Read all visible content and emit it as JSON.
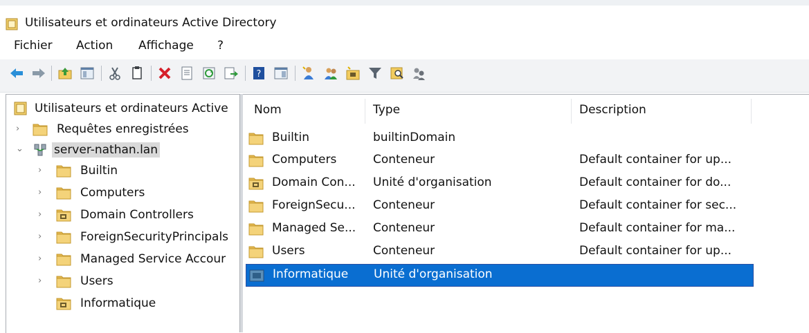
{
  "window": {
    "title": "Utilisateurs et ordinateurs Active Directory"
  },
  "menu": {
    "file": "Fichier",
    "action": "Action",
    "view": "Affichage",
    "help": "?"
  },
  "toolbar": {
    "icons": [
      "back-arrow-icon",
      "forward-arrow-icon",
      "up-folder-icon",
      "show-console-tree-icon",
      "cut-icon",
      "copy-icon",
      "delete-icon",
      "properties-icon",
      "refresh-icon",
      "export-list-icon",
      "help-icon",
      "console-icon",
      "new-user-icon",
      "new-group-icon",
      "new-ou-icon",
      "filter-icon",
      "find-icon",
      "delegate-icon"
    ]
  },
  "tree": {
    "root": "Utilisateurs et ordinateurs Active",
    "saved_queries": "Requêtes enregistrées",
    "domain": "server-nathan.lan",
    "children": [
      "Builtin",
      "Computers",
      "Domain Controllers",
      "ForeignSecurityPrincipals",
      "Managed Service Accour",
      "Users",
      "Informatique"
    ]
  },
  "list": {
    "headers": {
      "name": "Nom",
      "type": "Type",
      "description": "Description"
    },
    "rows": [
      {
        "name": "Builtin",
        "type": "builtinDomain",
        "description": ""
      },
      {
        "name": "Computers",
        "type": "Conteneur",
        "description": "Default container for up..."
      },
      {
        "name": "Domain Con...",
        "type": "Unité d'organisation",
        "description": "Default container for do..."
      },
      {
        "name": "ForeignSecu...",
        "type": "Conteneur",
        "description": "Default container for sec..."
      },
      {
        "name": "Managed Se...",
        "type": "Conteneur",
        "description": "Default container for ma..."
      },
      {
        "name": "Users",
        "type": "Conteneur",
        "description": "Default container for up..."
      },
      {
        "name": "Informatique",
        "type": "Unité d'organisation",
        "description": ""
      }
    ]
  },
  "colors": {
    "selection": "#0a6ed1",
    "folder": "#f0cd6a",
    "delete": "#d6202a"
  }
}
